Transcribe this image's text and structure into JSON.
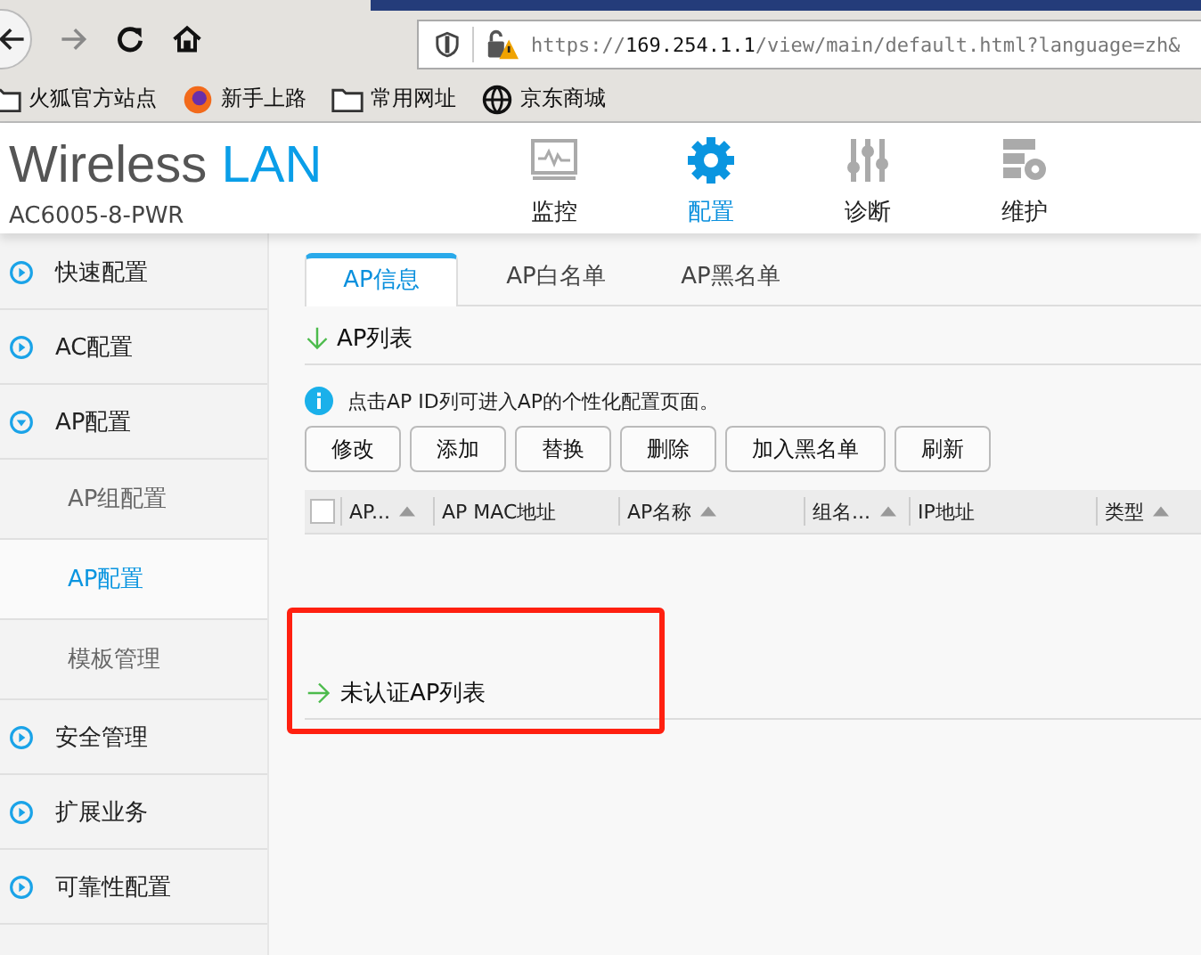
{
  "browser": {
    "url": {
      "scheme": "https://",
      "host": "169.254.1.1",
      "path": "/view/main/default.html?language=zh&"
    },
    "bookmarks": [
      {
        "kind": "folder",
        "label": "火狐官方站点"
      },
      {
        "kind": "firefox",
        "label": "新手上路"
      },
      {
        "kind": "folder",
        "label": "常用网址"
      },
      {
        "kind": "globe",
        "label": "京东商城"
      }
    ]
  },
  "header": {
    "logo": {
      "first": "Wireless",
      "second": "LAN"
    },
    "model": "AC6005-8-PWR",
    "nav": [
      {
        "kind": "monitor",
        "label": "监控",
        "selected": false
      },
      {
        "kind": "gear",
        "label": "配置",
        "selected": true
      },
      {
        "kind": "sliders",
        "label": "诊断",
        "selected": false
      },
      {
        "kind": "server",
        "label": "维护",
        "selected": false
      }
    ]
  },
  "sidebar": {
    "items": [
      {
        "label": "快速配置",
        "expanded": false
      },
      {
        "label": "AC配置",
        "expanded": false
      },
      {
        "label": "AP配置",
        "expanded": true,
        "children": [
          {
            "label": "AP组配置",
            "selected": false
          },
          {
            "label": "AP配置",
            "selected": true
          },
          {
            "label": "模板管理",
            "selected": false
          }
        ]
      },
      {
        "label": "安全管理",
        "expanded": false
      },
      {
        "label": "扩展业务",
        "expanded": false
      },
      {
        "label": "可靠性配置",
        "expanded": false
      }
    ]
  },
  "tabs": [
    {
      "label": "AP信息",
      "selected": true
    },
    {
      "label": "AP白名单",
      "selected": false
    },
    {
      "label": "AP黑名单",
      "selected": false
    }
  ],
  "sections": [
    {
      "title": "AP列表",
      "expanded": true,
      "highlighted": false,
      "info": "点击AP ID列可进入AP的个性化配置页面。",
      "buttons": [
        "修改",
        "添加",
        "替换",
        "删除",
        "加入黑名单",
        "刷新"
      ],
      "table": {
        "select_all": {
          "checked": false
        },
        "columns": [
          {
            "label": "AP...",
            "sortable": true
          },
          {
            "label": "AP MAC地址",
            "sortable": false
          },
          {
            "label": "AP名称",
            "sortable": true
          },
          {
            "label": "组名...",
            "sortable": true
          },
          {
            "label": "IP地址",
            "sortable": false
          },
          {
            "label": "类型",
            "sortable": true
          }
        ]
      }
    },
    {
      "title": "未认证AP列表",
      "expanded": false,
      "highlighted": true
    }
  ]
}
